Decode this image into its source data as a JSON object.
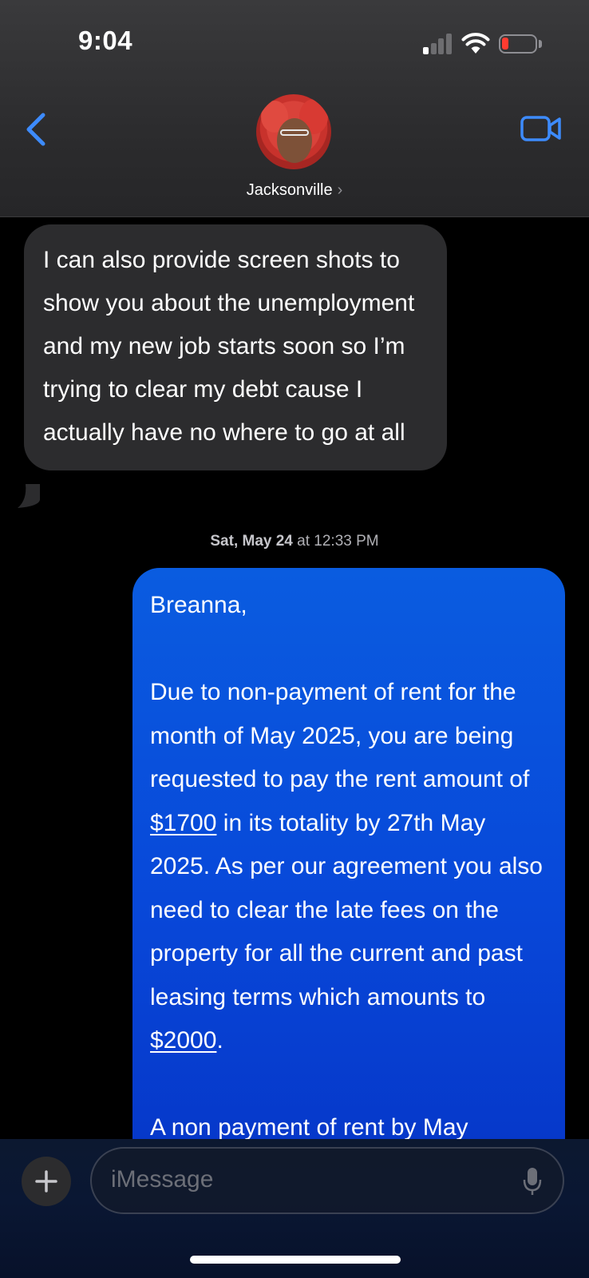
{
  "status_bar": {
    "time": "9:04"
  },
  "header": {
    "contact_name": "Jacksonville",
    "contact_chevron": "›"
  },
  "messages": {
    "incoming_1": "I can also provide screen shots to show you about the unemployment and my new job starts soon so I’m trying to clear my debt cause I actually have no where to go at all",
    "timestamp_day": "Sat, May 24",
    "timestamp_time": "at 12:33 PM",
    "outgoing_1": {
      "greeting": "Breanna,",
      "para1_part1": "Due to non-payment of rent for the month of May 2025, you are being requested to pay the rent amount of ",
      "amount_rent": "$1700",
      "para1_part2": " in its totality by 27th May 2025. As per our agreement you also need to clear the late fees on the property for all the current and past leasing terms which amounts to ",
      "amount_fees": "$2000",
      "para1_end": ".",
      "para2_visible": "A non payment of rent by May"
    }
  },
  "composer": {
    "placeholder": "iMessage"
  },
  "colors": {
    "outgoing_bubble": "#0a5ce0",
    "incoming_bubble": "#2c2c2e",
    "accent": "#3d8bfd",
    "battery_low": "#ff3b30"
  },
  "icons": {
    "back": "chevron-left-icon",
    "video": "video-camera-icon",
    "plus": "plus-icon",
    "mic": "microphone-icon"
  }
}
